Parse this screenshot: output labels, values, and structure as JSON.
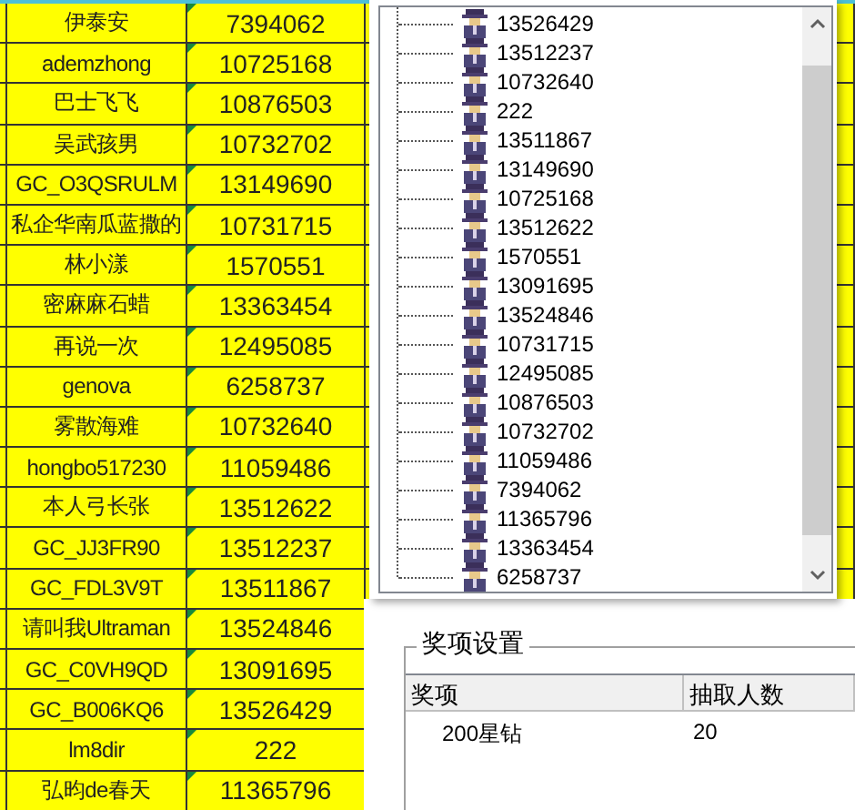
{
  "sheet": {
    "rows": [
      {
        "name": "伊泰安",
        "value": "7394062"
      },
      {
        "name": "ademzhong",
        "value": "10725168"
      },
      {
        "name": "巴士飞飞",
        "value": "10876503"
      },
      {
        "name": "吴武孩男",
        "value": "10732702"
      },
      {
        "name": "GC_O3QSRULM",
        "value": "13149690"
      },
      {
        "name": "私企华南瓜蓝撒的",
        "value": "10731715"
      },
      {
        "name": "林小漾",
        "value": "1570551"
      },
      {
        "name": "密麻麻石蜡",
        "value": "13363454"
      },
      {
        "name": "再说一次",
        "value": "12495085"
      },
      {
        "name": "genova",
        "value": "6258737"
      },
      {
        "name": "雾散海难",
        "value": "10732640"
      },
      {
        "name": "hongbo517230",
        "value": "11059486"
      },
      {
        "name": "本人弓长张",
        "value": "13512622"
      },
      {
        "name": "GC_JJ3FR90",
        "value": "13512237"
      },
      {
        "name": "GC_FDL3V9T",
        "value": "13511867"
      },
      {
        "name": "请叫我Ultraman",
        "value": "13524846"
      },
      {
        "name": "GC_C0VH9QD",
        "value": "13091695"
      },
      {
        "name": "GC_B006KQ6",
        "value": "13526429"
      },
      {
        "name": "lm8dir",
        "value": "222"
      },
      {
        "name": "弘昀de春天",
        "value": "11365796"
      }
    ]
  },
  "tree": {
    "items": [
      "13526429",
      "13512237",
      "10732640",
      "222",
      "13511867",
      "13149690",
      "10725168",
      "13512622",
      "1570551",
      "13091695",
      "13524846",
      "10731715",
      "12495085",
      "10876503",
      "10732702",
      "11059486",
      "7394062",
      "11365796",
      "13363454",
      "6258737"
    ]
  },
  "prize_group": {
    "title": "奖项设置",
    "columns": [
      "奖项",
      "抽取人数"
    ],
    "rows": [
      [
        "200星钻",
        "20"
      ]
    ]
  }
}
